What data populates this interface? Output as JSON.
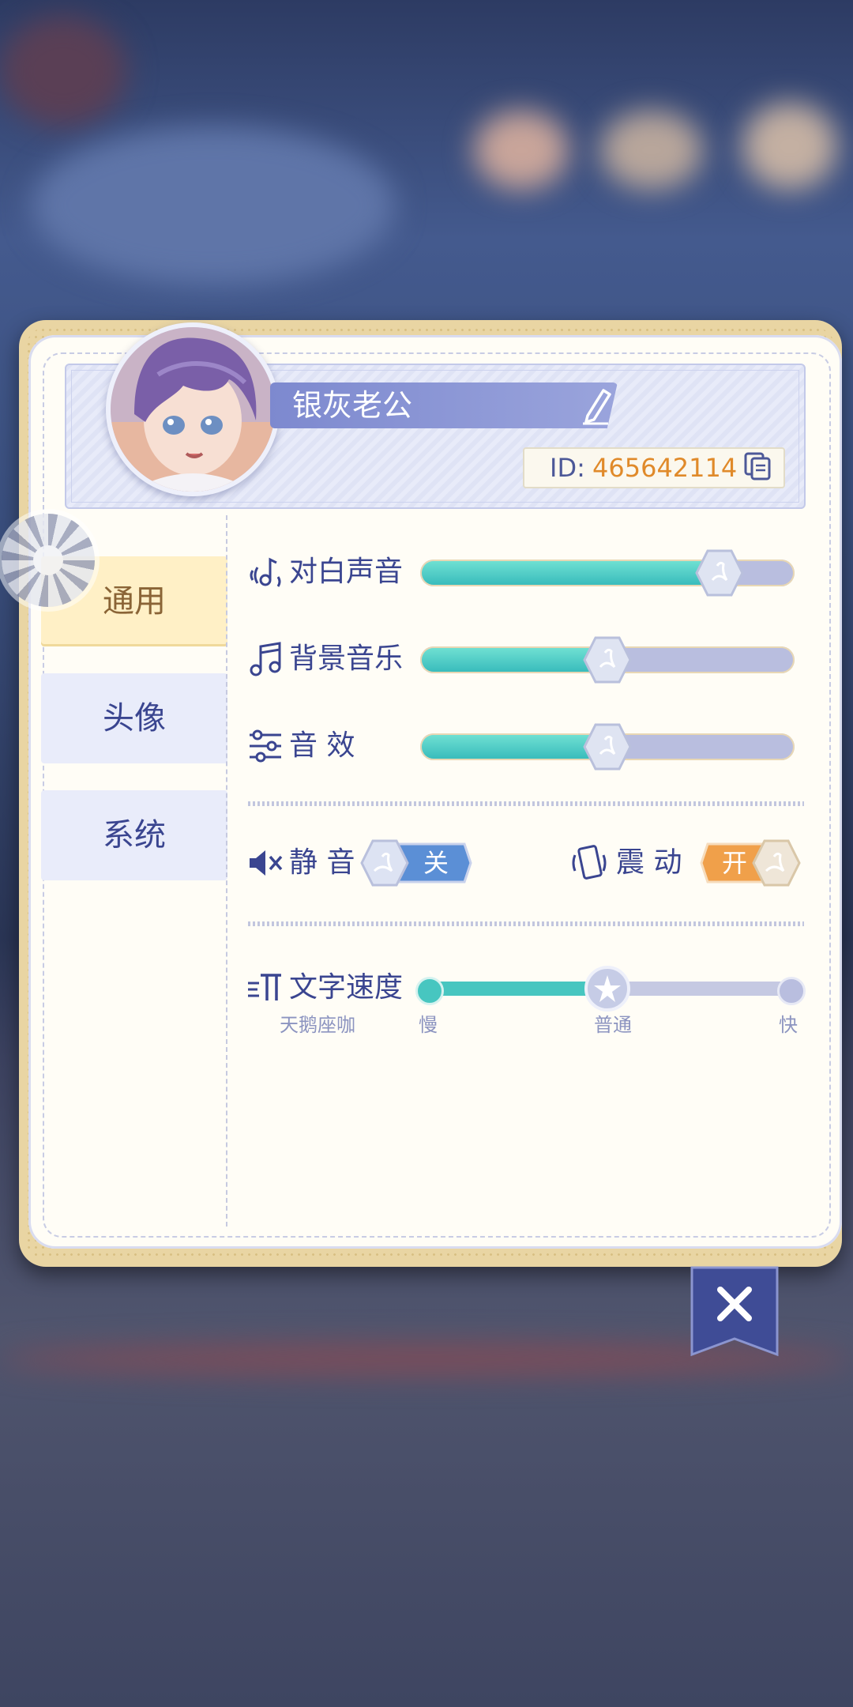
{
  "profile": {
    "name": "银灰老公",
    "id_label": "ID:",
    "id_value": "465642114"
  },
  "tabs": [
    {
      "label": "通用",
      "active": true
    },
    {
      "label": "头像",
      "active": false
    },
    {
      "label": "系统",
      "active": false
    }
  ],
  "audio": {
    "dialogue": {
      "label": "对白声音",
      "level": 0.8
    },
    "bgm": {
      "label": "背景音乐",
      "level": 0.5
    },
    "sfx": {
      "label": "音 效",
      "level": 0.5
    }
  },
  "toggles": {
    "mute": {
      "label": "静 音",
      "state": "关",
      "on": false
    },
    "vibrate": {
      "label": "震 动",
      "state": "开",
      "on": true
    }
  },
  "text_speed": {
    "label": "文字速度",
    "preview": "天鹅座咖",
    "min_label": "慢",
    "mid_label": "普通",
    "max_label": "快",
    "level": 0.5
  },
  "icons": {
    "edit": "pencil-icon",
    "copy": "copy-icon",
    "dialogue": "voice-note-icon",
    "bgm": "music-note-icon",
    "sfx": "equalizer-icon",
    "mute": "speaker-mute-icon",
    "vibrate": "phone-vibrate-icon",
    "text_speed": "text-speed-icon",
    "close": "close-icon",
    "loading": "loading-spinner-icon"
  },
  "colors": {
    "accent_teal": "#39bcbc",
    "accent_blue": "#3a4590",
    "id_orange": "#e08a2a",
    "active_tab": "#fff0c6",
    "toggle_off": "#5b8fd6",
    "toggle_on": "#f0a04a"
  }
}
